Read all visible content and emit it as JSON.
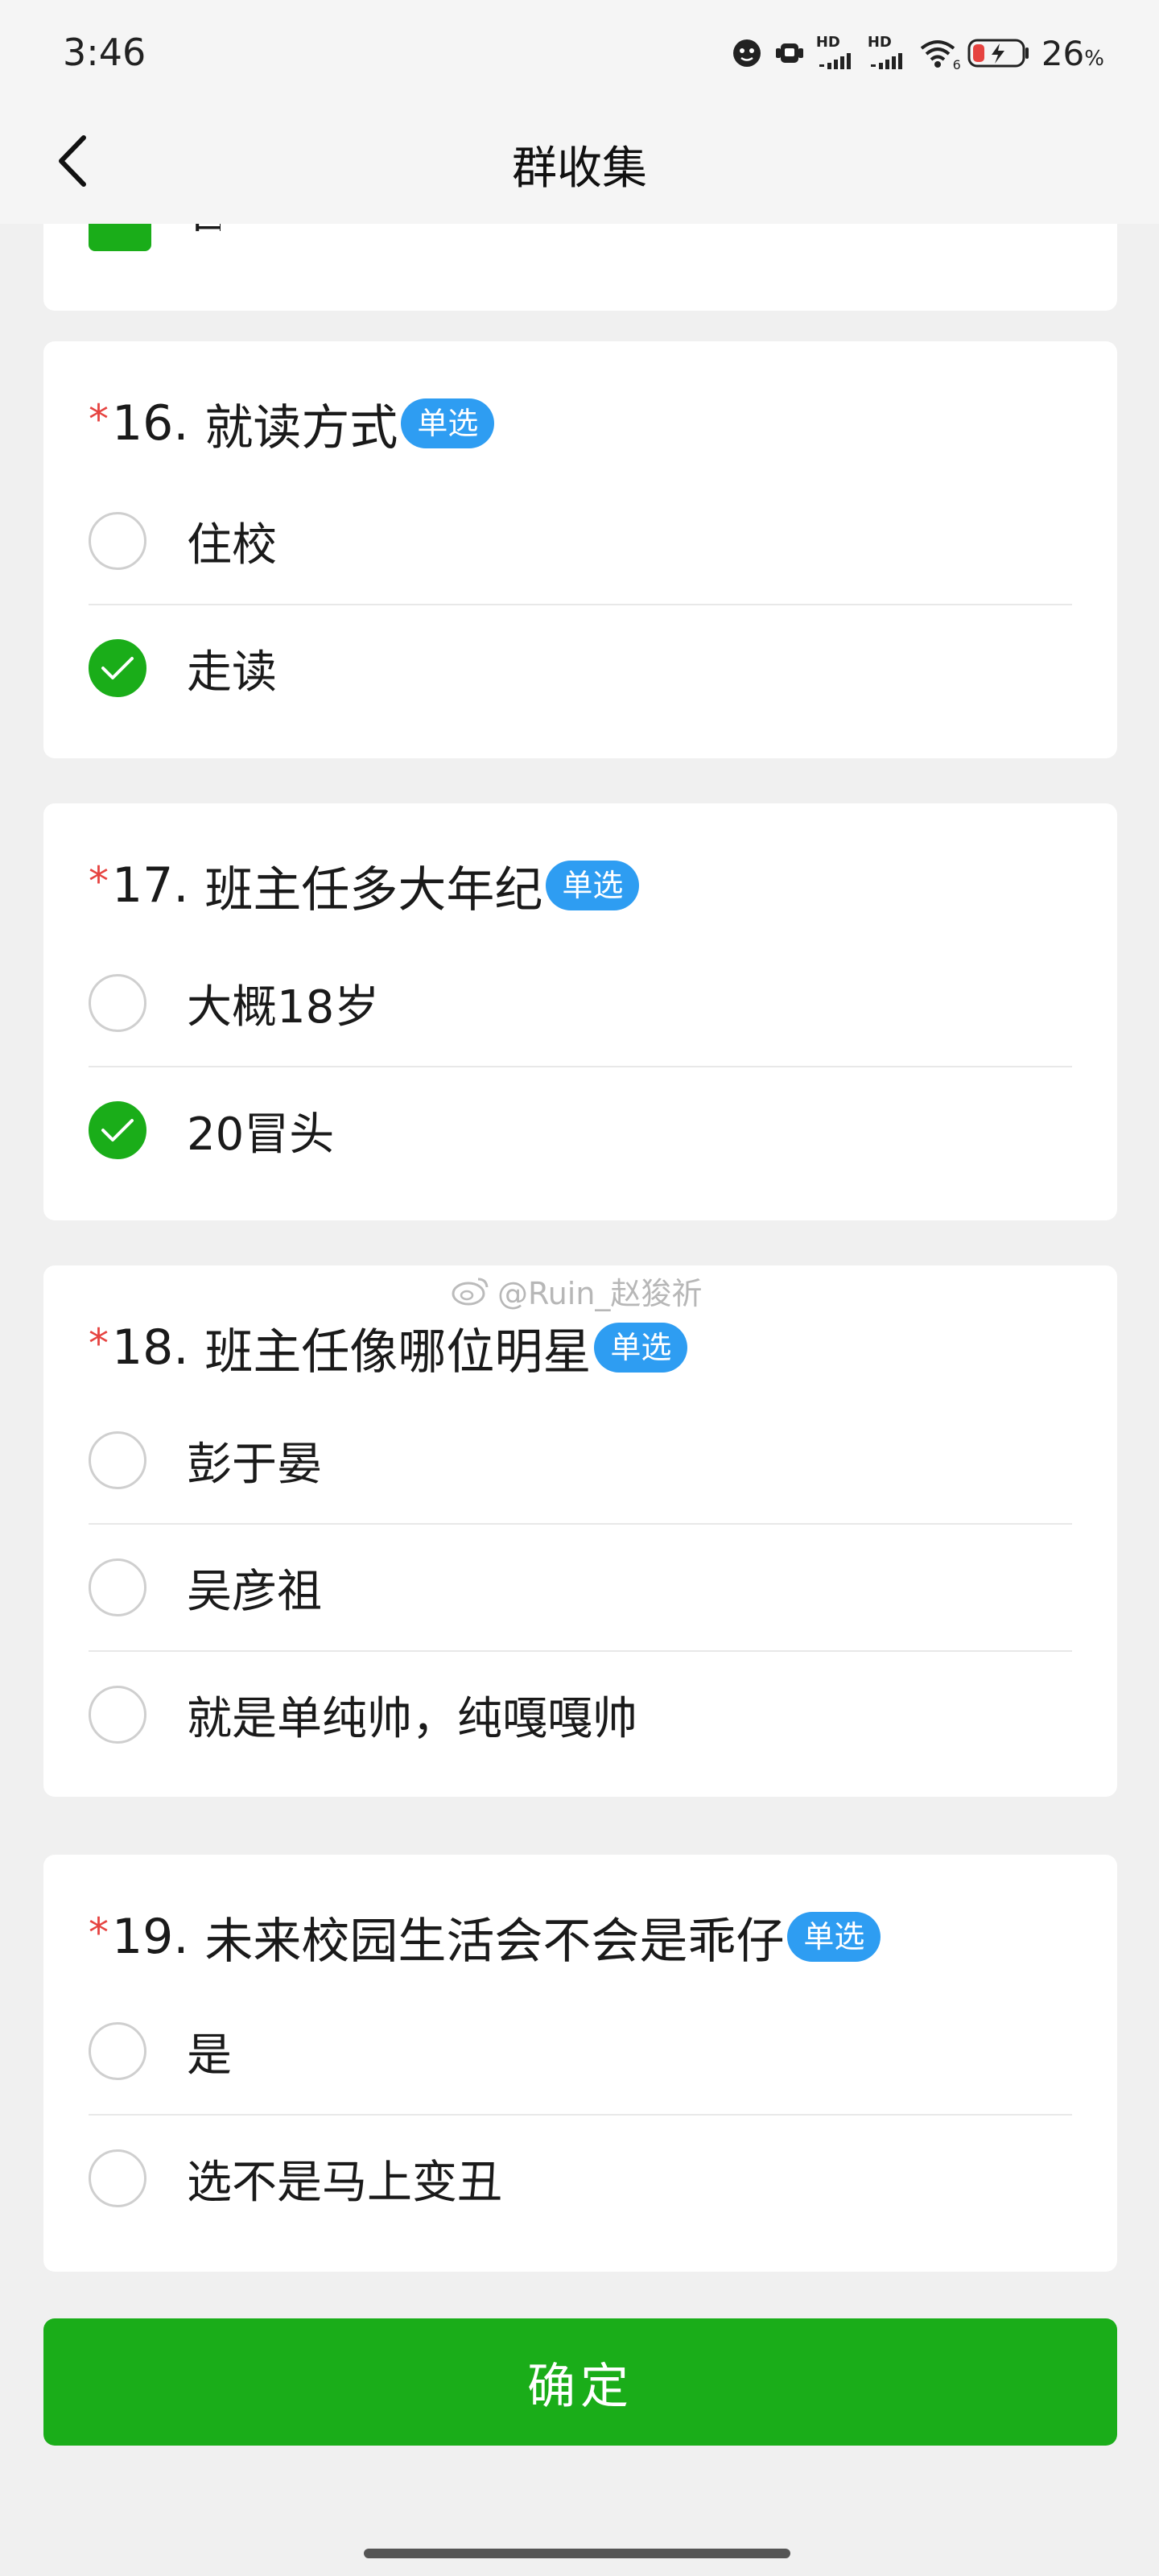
{
  "status_bar": {
    "time": "3:46",
    "battery_pct": "26",
    "battery_unit": "%",
    "icons": [
      "face-icon",
      "wearable-icon",
      "hd-signal-1-icon",
      "hd-signal-2-icon",
      "wifi-icon",
      "battery-icon"
    ],
    "hd1": "HD",
    "hd2": "HD",
    "wifi_sub": "6"
  },
  "nav": {
    "title": "群收集",
    "back_icon": "chevron-left-icon"
  },
  "partial_prev": {
    "selected": true
  },
  "questions": [
    {
      "required": "*",
      "number": "16.",
      "title": "就读方式",
      "type_badge": "单选",
      "options": [
        {
          "label": "住校",
          "selected": false
        },
        {
          "label": "走读",
          "selected": true
        }
      ]
    },
    {
      "required": "*",
      "number": "17.",
      "title": "班主任多大年纪",
      "type_badge": "单选",
      "options": [
        {
          "label": "大概18岁",
          "selected": false
        },
        {
          "label": "20冒头",
          "selected": true
        }
      ]
    },
    {
      "required": "*",
      "number": "18.",
      "title": "班主任像哪位明星",
      "type_badge": "单选",
      "options": [
        {
          "label": "彭于晏",
          "selected": false
        },
        {
          "label": "吴彦祖",
          "selected": false
        },
        {
          "label": "就是单纯帅，纯嘎嘎帅",
          "selected": false
        }
      ]
    },
    {
      "required": "*",
      "number": "19.",
      "title": "未来校园生活会不会是乖仔",
      "type_badge": "单选",
      "options": [
        {
          "label": "是",
          "selected": false
        },
        {
          "label": "选不是马上变丑",
          "selected": false
        }
      ]
    }
  ],
  "watermark": "@Ruin_赵狻祈",
  "confirm_label": "确定",
  "colors": {
    "accent_green": "#1aad19",
    "badge_blue": "#2e9df2",
    "required_red": "#e64340",
    "background": "#f0f0f0"
  }
}
